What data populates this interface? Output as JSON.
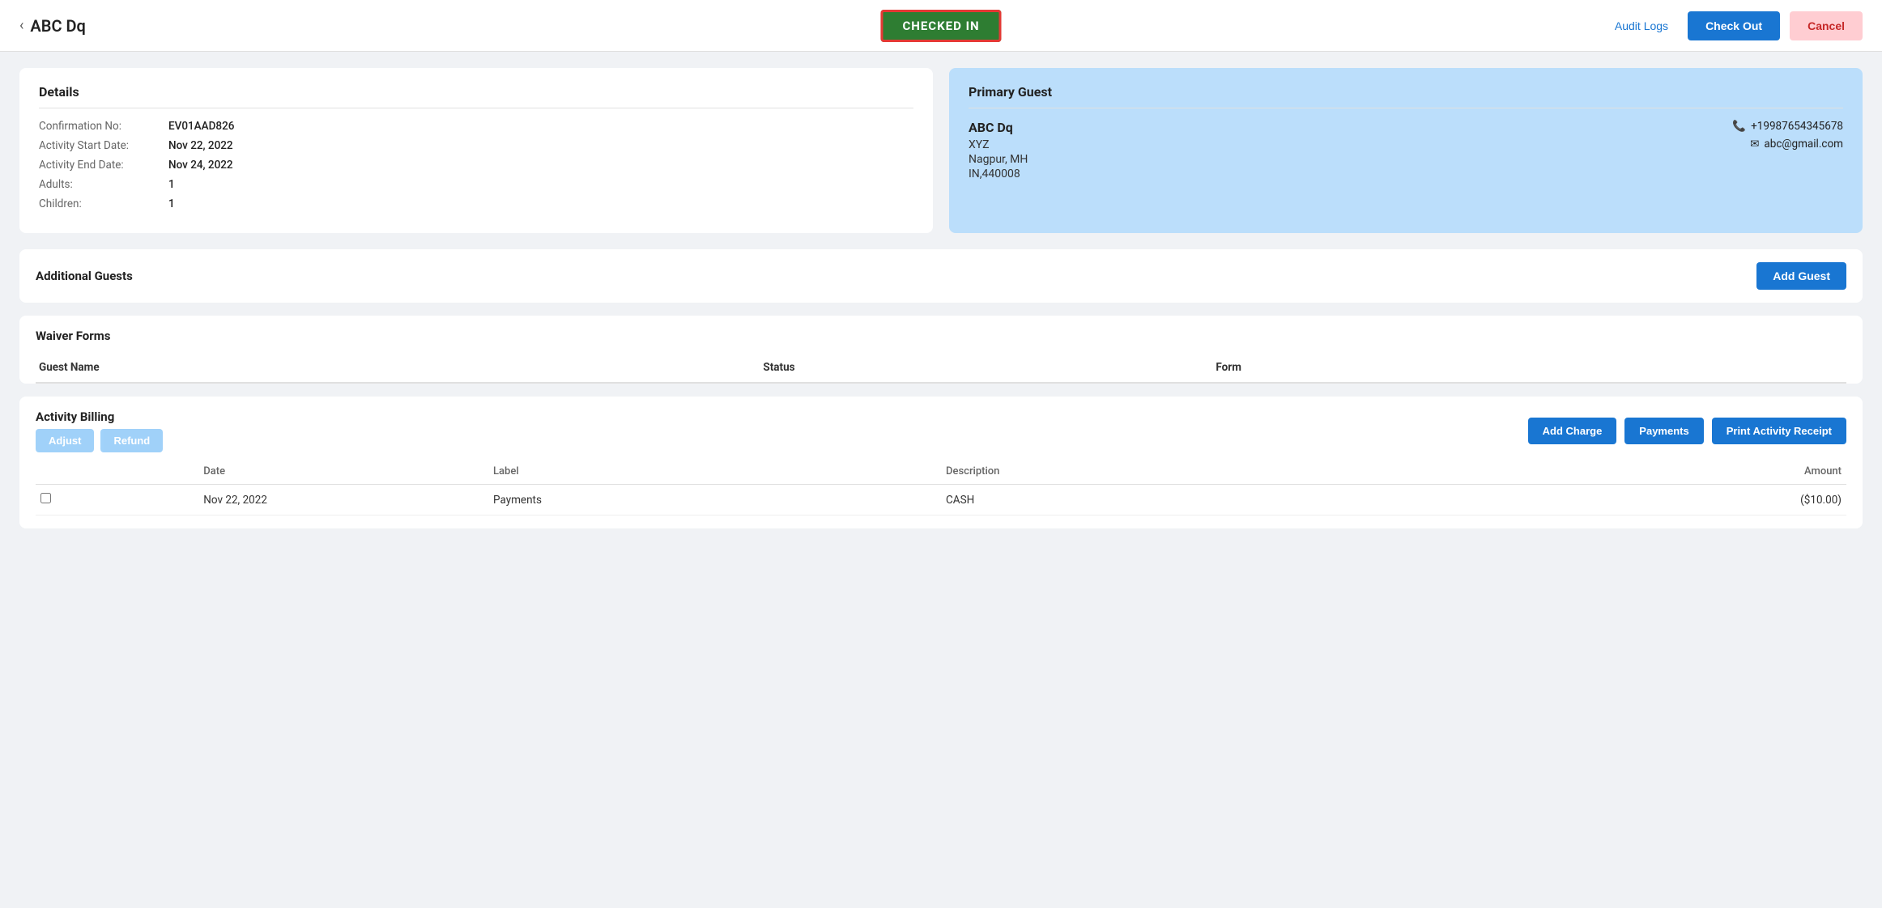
{
  "header": {
    "back_label": "‹",
    "title": "ABC  Dq",
    "status_badge": "CHECKED IN",
    "audit_logs_label": "Audit Logs",
    "checkout_label": "Check Out",
    "cancel_label": "Cancel"
  },
  "details": {
    "section_title": "Details",
    "confirmation_label": "Confirmation No:",
    "confirmation_value": "EV01AAD826",
    "start_date_label": "Activity Start Date:",
    "start_date_value": "Nov 22, 2022",
    "end_date_label": "Activity End Date:",
    "end_date_value": "Nov 24, 2022",
    "adults_label": "Adults:",
    "adults_value": "1",
    "children_label": "Children:",
    "children_value": "1"
  },
  "primary_guest": {
    "section_title": "Primary Guest",
    "name": "ABC  Dq",
    "org": "XYZ",
    "city_state": "Nagpur, MH",
    "country_zip": "IN,440008",
    "phone_icon": "📞",
    "phone": "+19987654345678",
    "email_icon": "✉",
    "email": "abc@gmail.com"
  },
  "additional_guests": {
    "section_title": "Additional Guests",
    "add_guest_label": "Add Guest"
  },
  "waiver_forms": {
    "section_title": "Waiver Forms",
    "columns": [
      "Guest Name",
      "Status",
      "Form"
    ],
    "rows": []
  },
  "activity_billing": {
    "section_title": "Activity Billing",
    "adjust_label": "Adjust",
    "refund_label": "Refund",
    "add_charge_label": "Add Charge",
    "payments_label": "Payments",
    "print_receipt_label": "Print Activity Receipt",
    "table_columns": [
      "",
      "Date",
      "Label",
      "Description",
      "Amount"
    ],
    "rows": [
      {
        "checked": false,
        "date": "Nov 22, 2022",
        "label": "Payments",
        "description": "CASH",
        "amount": "($10.00)"
      }
    ]
  }
}
